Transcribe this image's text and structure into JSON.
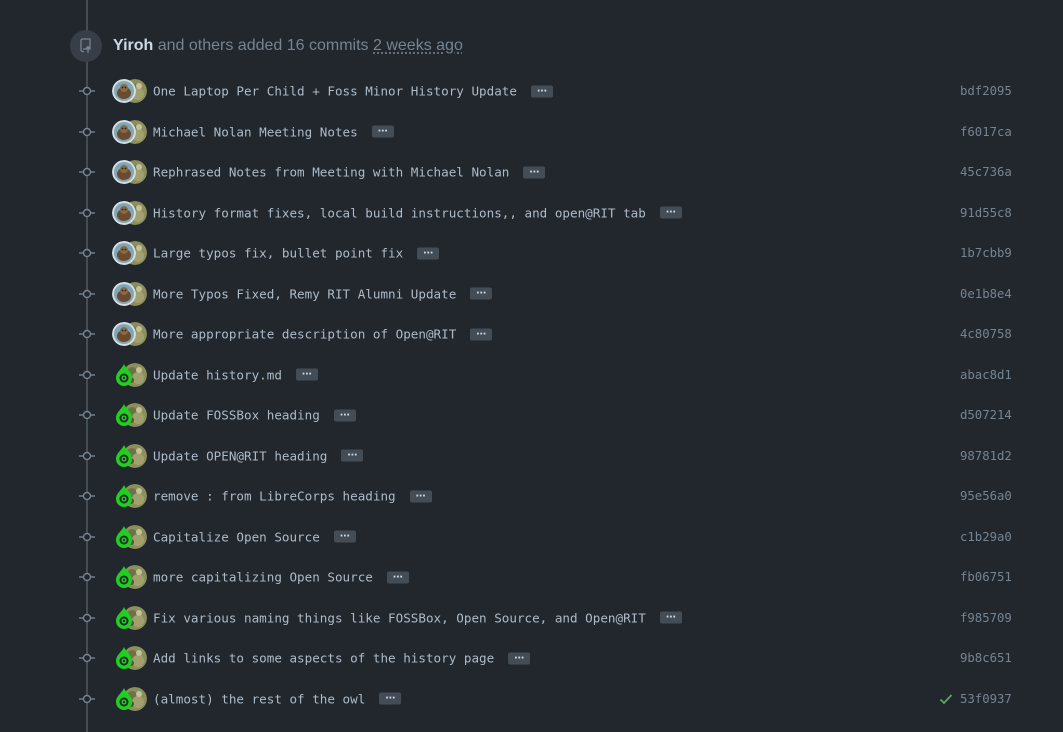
{
  "header": {
    "author": "Yiroh",
    "summary": "and others added 16 commits",
    "time": "2 weeks ago",
    "icon": "repo-push-icon"
  },
  "colors": {
    "background": "#22272e",
    "timeline": "#444c56",
    "text": "#adbac7",
    "muted": "#768390",
    "success": "#57ab5a"
  },
  "commits": [
    {
      "message": "One Laptop Per Child + Foss Minor History Update",
      "sha": "bdf2095",
      "avatar": "photo",
      "check": false
    },
    {
      "message": "Michael Nolan Meeting Notes",
      "sha": "f6017ca",
      "avatar": "photo",
      "check": false
    },
    {
      "message": "Rephrased Notes from Meeting with Michael Nolan",
      "sha": "45c736a",
      "avatar": "photo",
      "check": false
    },
    {
      "message": "History format fixes, local build instructions,, and open@RIT tab",
      "sha": "91d55c8",
      "avatar": "photo",
      "check": false
    },
    {
      "message": "Large typos fix, bullet point fix",
      "sha": "1b7cbb9",
      "avatar": "photo",
      "check": false
    },
    {
      "message": "More Typos Fixed, Remy RIT Alumni Update",
      "sha": "0e1b8e4",
      "avatar": "photo",
      "check": false
    },
    {
      "message": "More appropriate description of Open@RIT",
      "sha": "4c80758",
      "avatar": "photo",
      "check": false
    },
    {
      "message": "Update history.md",
      "sha": "abac8d1",
      "avatar": "green",
      "check": false
    },
    {
      "message": "Update FOSSBox heading",
      "sha": "d507214",
      "avatar": "green",
      "check": false
    },
    {
      "message": "Update OPEN@RIT heading",
      "sha": "98781d2",
      "avatar": "green",
      "check": false
    },
    {
      "message": "remove : from LibreCorps heading",
      "sha": "95e56a0",
      "avatar": "green",
      "check": false
    },
    {
      "message": "Capitalize Open Source",
      "sha": "c1b29a0",
      "avatar": "green",
      "check": false
    },
    {
      "message": "more capitalizing Open Source",
      "sha": "fb06751",
      "avatar": "green",
      "check": false
    },
    {
      "message": "Fix various naming things like FOSSBox, Open Source, and Open@RIT",
      "sha": "f985709",
      "avatar": "green",
      "check": false
    },
    {
      "message": "Add links to some aspects of the history page",
      "sha": "9b8c651",
      "avatar": "green",
      "check": false
    },
    {
      "message": "(almost) the rest of the owl",
      "sha": "53f0937",
      "avatar": "green",
      "check": true
    }
  ],
  "ellipsis_label": "…"
}
